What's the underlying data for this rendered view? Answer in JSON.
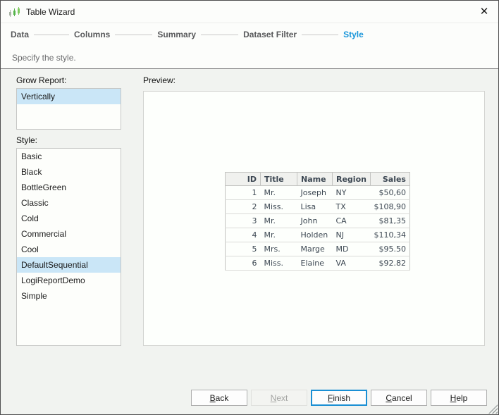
{
  "window": {
    "title": "Table Wizard"
  },
  "icons": {
    "close": "✕",
    "app": "bar-chart-icon"
  },
  "steps": {
    "items": [
      {
        "label": "Data",
        "active": false
      },
      {
        "label": "Columns",
        "active": false
      },
      {
        "label": "Summary",
        "active": false
      },
      {
        "label": "Dataset Filter",
        "active": false
      },
      {
        "label": "Style",
        "active": true
      }
    ]
  },
  "subtitle": "Specify the style.",
  "grow_report": {
    "label": "Grow Report:",
    "selected": "Vertically",
    "options": [
      "Vertically"
    ]
  },
  "style_list": {
    "label": "Style:",
    "selected": "DefaultSequential",
    "options": [
      "Basic",
      "Black",
      "BottleGreen",
      "Classic",
      "Cold",
      "Commercial",
      "Cool",
      "DefaultSequential",
      "LogiReportDemo",
      "Simple"
    ]
  },
  "preview": {
    "label": "Preview:",
    "table": {
      "headers": [
        "ID",
        "Title",
        "Name",
        "Region",
        "Sales"
      ],
      "rows": [
        [
          "1",
          "Mr.",
          "Joseph",
          "NY",
          "$50,60"
        ],
        [
          "2",
          "Miss.",
          "Lisa",
          "TX",
          "$108,90"
        ],
        [
          "3",
          "Mr.",
          "John",
          "CA",
          "$81,35"
        ],
        [
          "4",
          "Mr.",
          "Holden",
          "NJ",
          "$110,34"
        ],
        [
          "5",
          "Mrs.",
          "Marge",
          "MD",
          "$95.50"
        ],
        [
          "6",
          "Miss.",
          "Elaine",
          "VA",
          "$92.82"
        ]
      ]
    }
  },
  "buttons": {
    "back": "Back",
    "next": "Next",
    "finish": "Finish",
    "cancel": "Cancel",
    "help": "Help"
  },
  "colors": {
    "accent_blue": "#1a96da",
    "selection_blue": "#cae6f7",
    "step_inactive": "#58595b",
    "finish_border": "#1a8fd4"
  }
}
